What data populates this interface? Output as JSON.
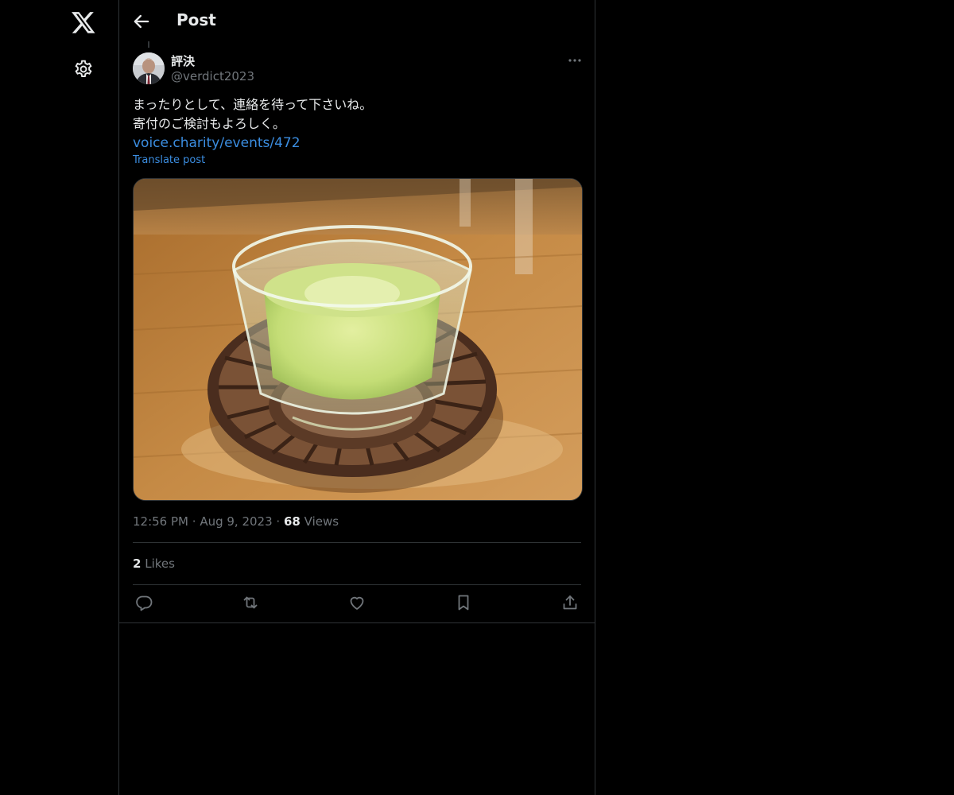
{
  "header": {
    "title": "Post"
  },
  "post": {
    "display_name": "評決",
    "handle": "@verdict2023",
    "text_lines": [
      "まったりとして、連絡を待って下さいね。",
      "寄付のご検討もよろしく。"
    ],
    "link_text": "voice.charity/events/472",
    "translate_label": "Translate post",
    "time": "12:56 PM",
    "date": "Aug 9, 2023",
    "views_count": "68",
    "views_label": "Views",
    "likes_count": "2",
    "likes_label": "Likes",
    "separator": "·"
  },
  "icons": {
    "logo": "x-logo-icon",
    "settings": "gear-icon",
    "back": "arrow-left-icon",
    "more": "ellipsis-icon",
    "reply": "reply-icon",
    "repost": "repost-icon",
    "like": "heart-icon",
    "bookmark": "bookmark-icon",
    "share": "share-icon"
  },
  "colors": {
    "background": "#000000",
    "text": "#e7e9ea",
    "secondary_text": "#71767b",
    "link": "#3b8de0",
    "border": "#2f3336"
  }
}
